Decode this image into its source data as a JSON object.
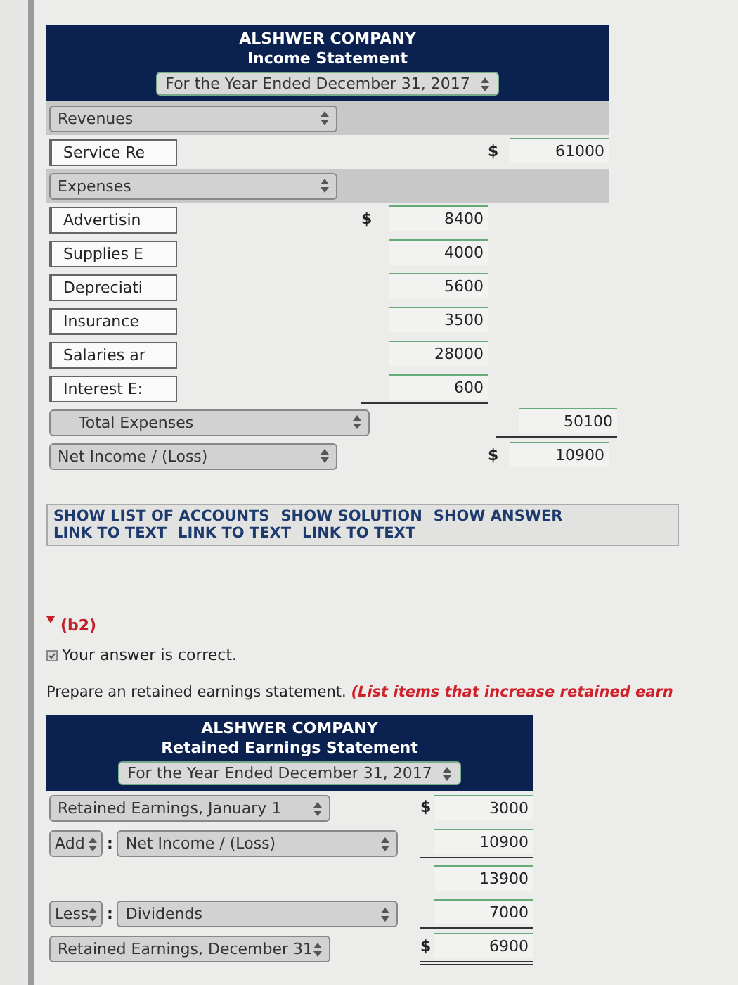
{
  "income_statement": {
    "company": "ALSHWER COMPANY",
    "title": "Income Statement",
    "period": "For the Year Ended December 31, 2017",
    "rows": [
      {
        "kind": "heading",
        "label": "Revenues"
      },
      {
        "kind": "account",
        "label": "Service Re",
        "currency": "$",
        "outer_amount": "61000",
        "underline": false
      },
      {
        "kind": "heading",
        "label": "Expenses"
      },
      {
        "kind": "account",
        "label": "Advertisin",
        "currency": "$",
        "inner_amount": "8400",
        "underline": false
      },
      {
        "kind": "account",
        "label": "Supplies E",
        "inner_amount": "4000",
        "underline": false
      },
      {
        "kind": "account",
        "label": "Depreciati",
        "inner_amount": "5600",
        "underline": false
      },
      {
        "kind": "account",
        "label": "Insurance",
        "inner_amount": "3500",
        "underline": false
      },
      {
        "kind": "account",
        "label": "Salaries ar",
        "inner_amount": "28000",
        "underline": false
      },
      {
        "kind": "account",
        "label": "Interest E:",
        "inner_amount": "600",
        "underline": true
      },
      {
        "kind": "total",
        "label": "Total Expenses",
        "outer_amount": "50100",
        "underline": true
      },
      {
        "kind": "select",
        "label": "Net Income / (Loss)",
        "currency": "$",
        "outer_amount": "10900",
        "underline": false
      }
    ]
  },
  "links": [
    "SHOW LIST OF ACCOUNTS",
    "SHOW SOLUTION",
    "SHOW ANSWER",
    "LINK TO TEXT",
    "LINK TO TEXT",
    "LINK TO TEXT"
  ],
  "part": {
    "label": "(b2)",
    "feedback": "Your answer is correct.",
    "prompt": "Prepare an retained earnings statement. *(List items that increase retained earn*"
  },
  "retained_statement": {
    "company": "ALSHWER COMPANY",
    "title": "Retained Earnings Statement",
    "period": "For the Year Ended December 31, 2017",
    "rows": [
      {
        "kind": "select",
        "label": "Retained Earnings, January 1",
        "currency": "$",
        "amount": "3000",
        "underline": false,
        "double_underline": false
      },
      {
        "kind": "operation",
        "operator": "Add",
        "separator": ":",
        "label": "Net Income / (Loss)",
        "amount": "10900",
        "underline": true,
        "double_underline": false
      },
      {
        "kind": "subtotal",
        "amount": "13900",
        "underline": false,
        "double_underline": false
      },
      {
        "kind": "operation",
        "operator": "Less",
        "separator": ":",
        "label": "Dividends",
        "amount": "7000",
        "underline": true,
        "double_underline": false
      },
      {
        "kind": "select",
        "label": "Retained Earnings, December 31",
        "currency": "$",
        "amount": "6900",
        "underline": false,
        "double_underline": true
      }
    ]
  }
}
